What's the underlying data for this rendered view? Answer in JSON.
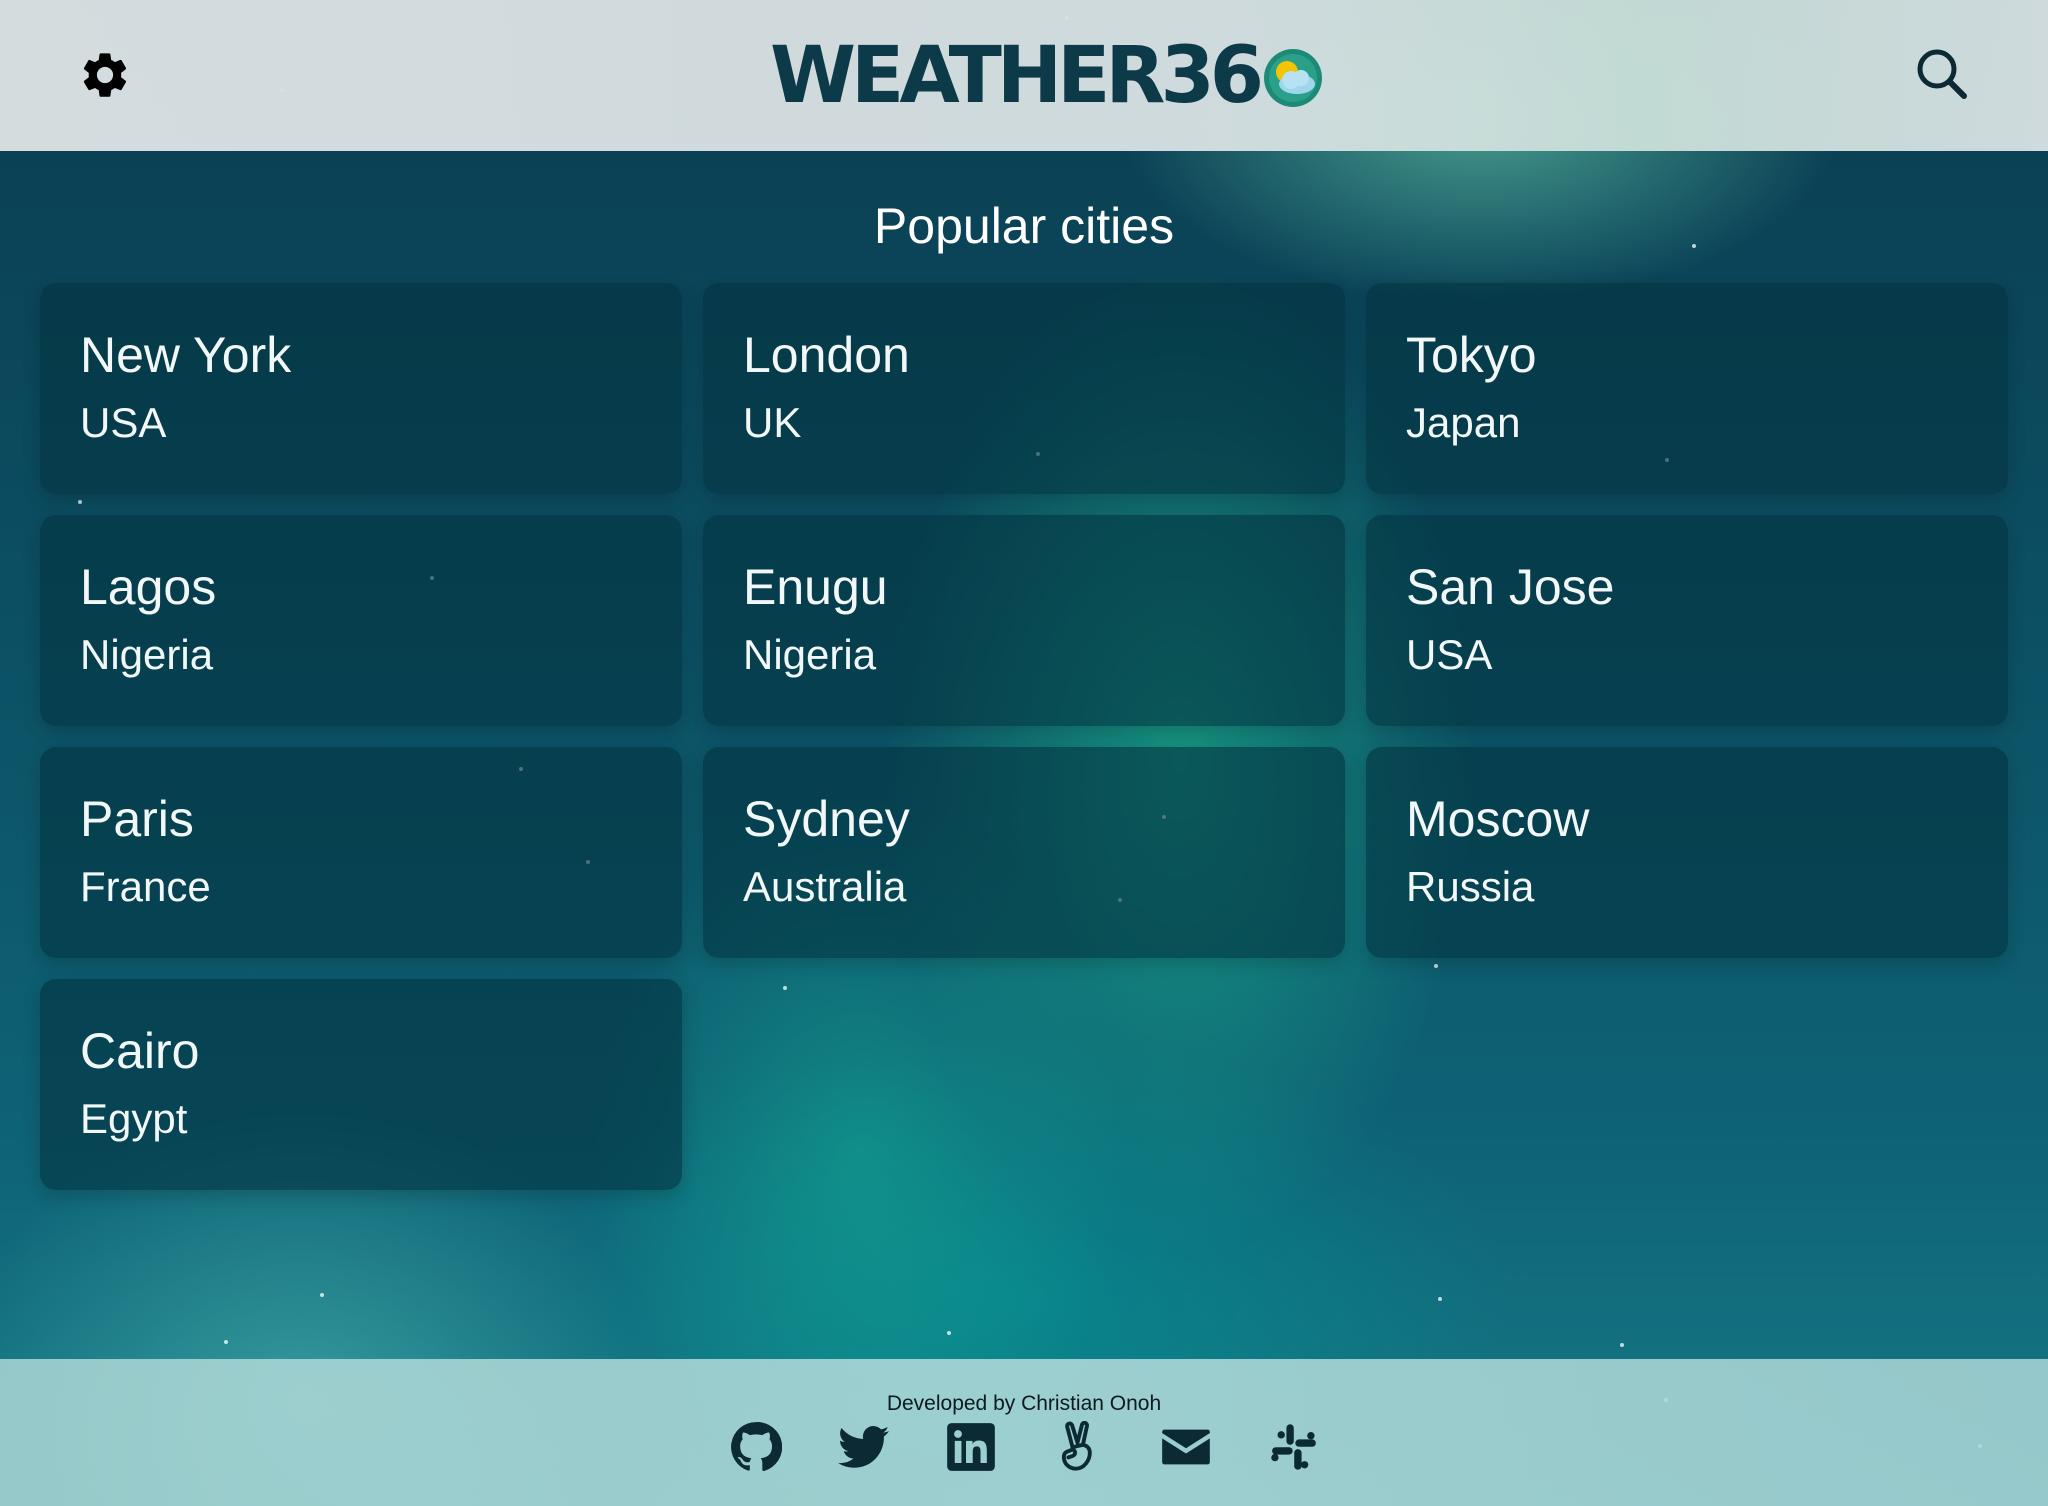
{
  "header": {
    "logo_text": "WEATHER36"
  },
  "main": {
    "title": "Popular cities",
    "cities": [
      {
        "city": "New York",
        "country": "USA"
      },
      {
        "city": "London",
        "country": "UK"
      },
      {
        "city": "Tokyo",
        "country": "Japan"
      },
      {
        "city": "Lagos",
        "country": "Nigeria"
      },
      {
        "city": "Enugu",
        "country": "Nigeria"
      },
      {
        "city": "San Jose",
        "country": "USA"
      },
      {
        "city": "Paris",
        "country": "France"
      },
      {
        "city": "Sydney",
        "country": "Australia"
      },
      {
        "city": "Moscow",
        "country": "Russia"
      },
      {
        "city": "Cairo",
        "country": "Egypt"
      }
    ]
  },
  "footer": {
    "credit": "Developed by Christian Onoh",
    "social_icons": [
      "github-icon",
      "twitter-icon",
      "linkedin-icon",
      "peace-icon",
      "email-icon",
      "slack-icon"
    ]
  },
  "colors": {
    "logo": "#0d3a48",
    "card_bg": "rgba(4,52,64,0.62)",
    "text": "#ffffff"
  }
}
